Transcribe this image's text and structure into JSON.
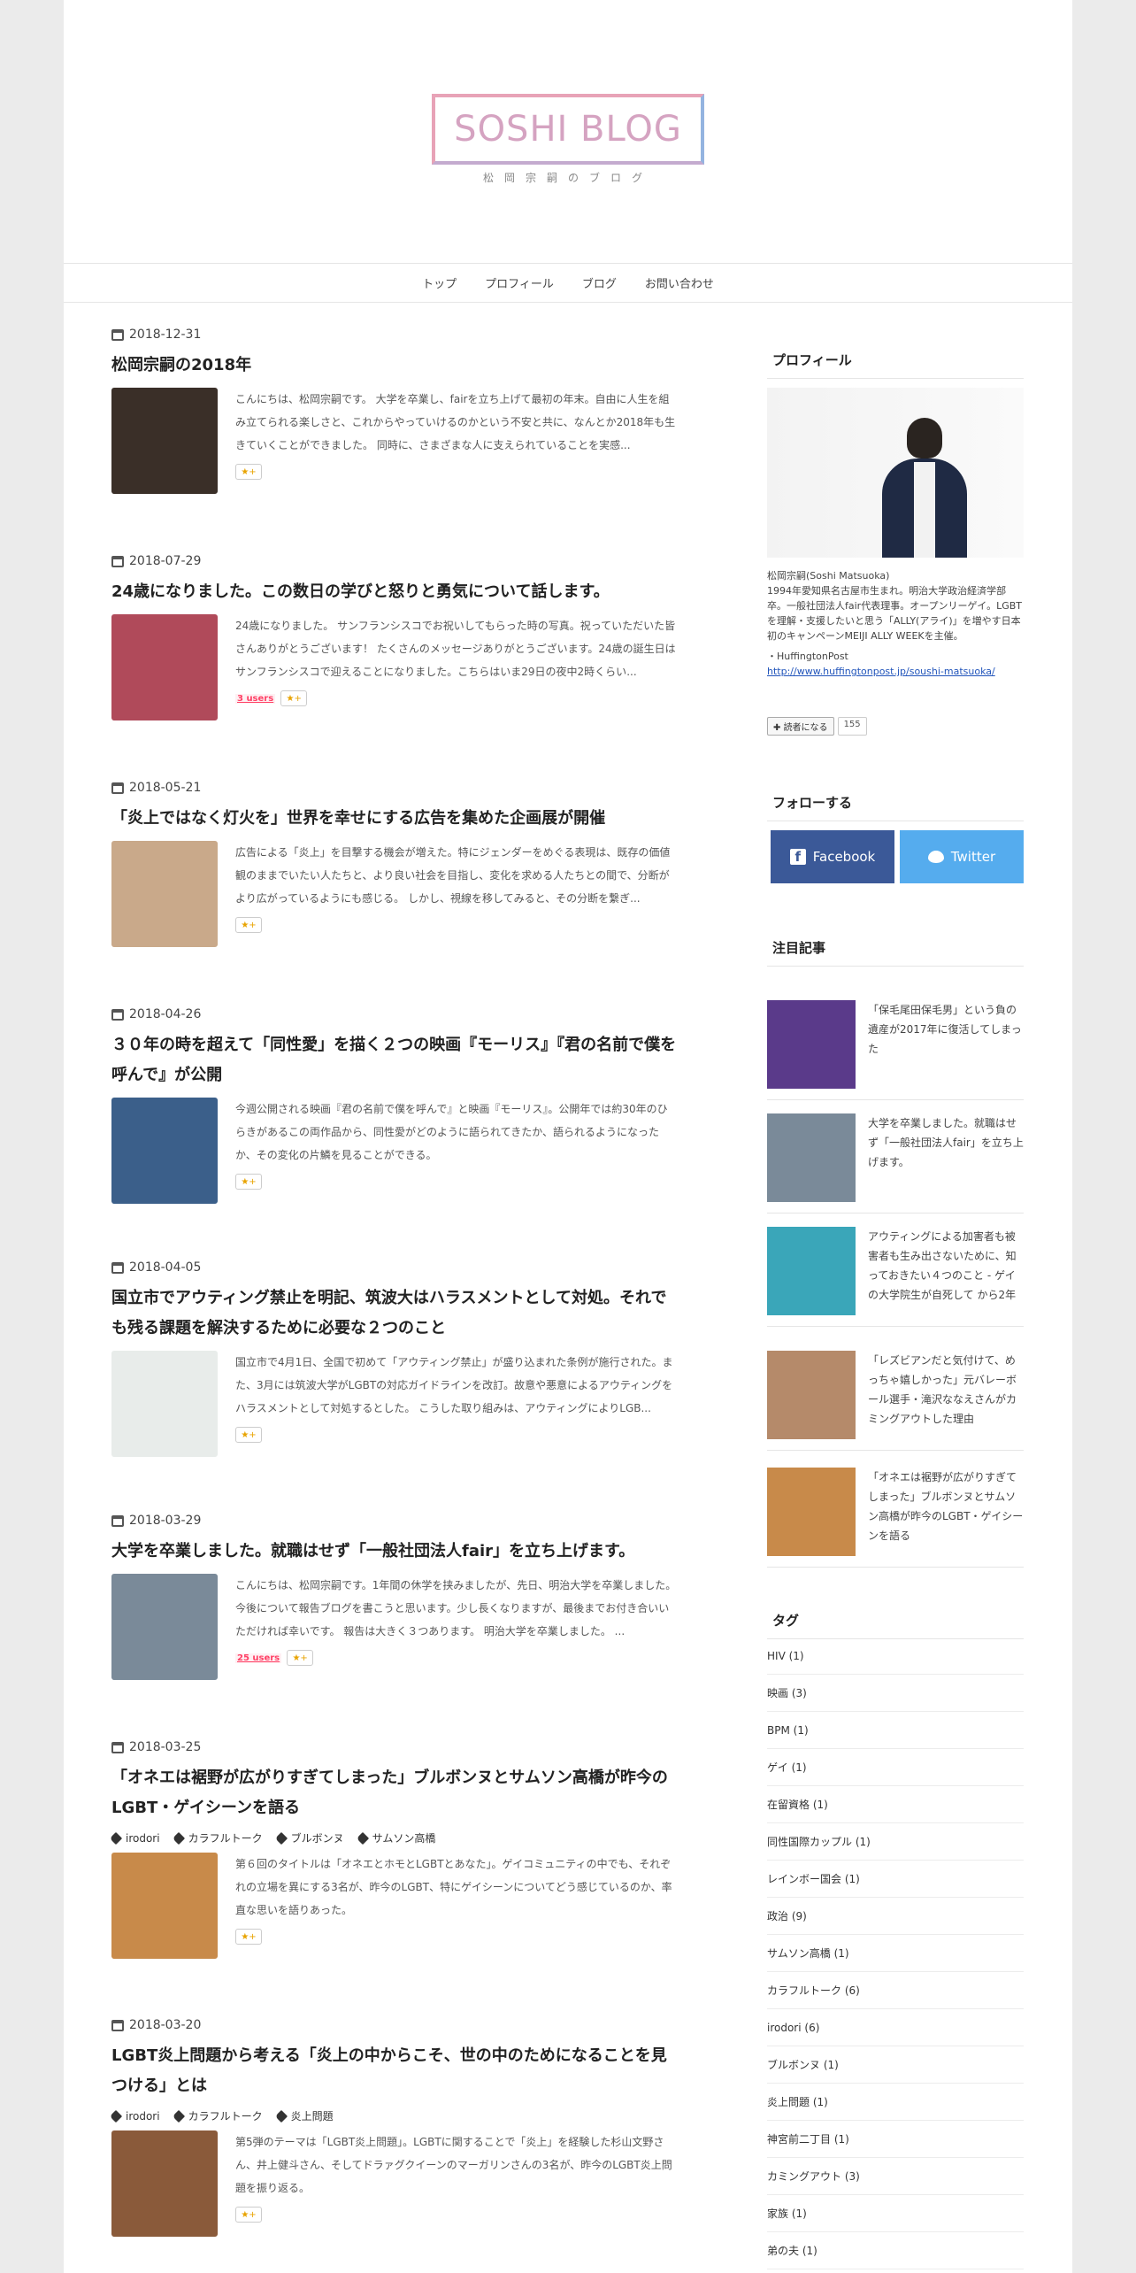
{
  "blog": {
    "title": "SOSHI BLOG",
    "subtitle": "松岡宗嗣のブログ"
  },
  "nav": [
    "トップ",
    "プロフィール",
    "ブログ",
    "お問い合わせ"
  ],
  "entries": [
    {
      "date": "2018-12-31",
      "title": "松岡宗嗣の2018年",
      "excerpt": "こんにちは、松岡宗嗣です。 大学を卒業し、fairを立ち上げて最初の年末。自由に人生を組み立てられる楽しさと、これからやっていけるのかという不安と共に、なんとか2018年も生きていくことができました。 同時に、さまざまな人に支えられていることを実感...",
      "users": "",
      "thumb_color": "#3a2f28"
    },
    {
      "date": "2018-07-29",
      "title": "24歳になりました。この数日の学びと怒りと勇気について話します。",
      "excerpt": "24歳になりました。 サンフランシスコでお祝いしてもらった時の写真。祝っていただいた皆さんありがとうございます！ たくさんのメッセージありがとうございます。24歳の誕生日はサンフランシスコで迎えることになりました。こちらはいま29日の夜中2時くらい...",
      "users": "3 users",
      "thumb_color": "#b04a5a"
    },
    {
      "date": "2018-05-21",
      "title": "「炎上ではなく灯火を」世界を幸せにする広告を集めた企画展が開催",
      "excerpt": "広告による「炎上」を目撃する機会が増えた。特にジェンダーをめぐる表現は、既存の価値観のままでいたい人たちと、より良い社会を目指し、変化を求める人たちとの間で、分断がより広がっているようにも感じる。 しかし、視線を移してみると、その分断を繋ぎ...",
      "users": "",
      "thumb_color": "#c9a98a"
    },
    {
      "date": "2018-04-26",
      "title": "３０年の時を超えて「同性愛」を描く２つの映画『モーリス』『君の名前で僕を呼んで』が公開",
      "excerpt": "今週公開される映画『君の名前で僕を呼んで』と映画『モーリス』。公開年では約30年のひらきがあるこの両作品から、同性愛がどのように語られてきたか、語られるようになったか、その変化の片鱗を見ることができる。",
      "users": "",
      "thumb_color": "#3b5f8a"
    },
    {
      "date": "2018-04-05",
      "title": "国立市でアウティング禁止を明記、筑波大はハラスメントとして対処。それでも残る課題を解決するために必要な２つのこと",
      "excerpt": "国立市で4月1日、全国で初めて「アウティング禁止」が盛り込まれた条例が施行された。また、3月には筑波大学がLGBTの対応ガイドラインを改訂。故意や悪意によるアウティングをハラスメントとして対処するとした。 こうした取り組みは、アウティングによりLGB...",
      "users": "",
      "thumb_color": "#e8ecea"
    },
    {
      "date": "2018-03-29",
      "title": "大学を卒業しました。就職はせず「一般社団法人fair」を立ち上げます。",
      "excerpt": "こんにちは、松岡宗嗣です。1年間の休学を挟みましたが、先日、明治大学を卒業しました。 今後について報告ブログを書こうと思います。少し長くなりますが、最後までお付き合いいただければ幸いです。 報告は大きく３つあります。 明治大学を卒業しました。 ...",
      "users": "25 users",
      "thumb_color": "#7a8a99"
    },
    {
      "date": "2018-03-25",
      "title": "「オネエは裾野が広がりすぎてしまった」ブルボンヌとサムソン高橋が昨今のLGBT・ゲイシーンを語る",
      "tags": [
        "irodori",
        "カラフルトーク",
        "ブルボンヌ",
        "サムソン高橋"
      ],
      "excerpt": "第６回のタイトルは「オネエとホモとLGBTとあなた」。ゲイコミュニティの中でも、それぞれの立場を異にする3名が、昨今のLGBT、特にゲイシーンについてどう感じているのか、率直な思いを語りあった。",
      "users": "",
      "thumb_color": "#c88a4a"
    },
    {
      "date": "2018-03-20",
      "title": "LGBT炎上問題から考える「炎上の中からこそ、世の中のためになることを見つける」とは",
      "tags": [
        "irodori",
        "カラフルトーク",
        "炎上問題"
      ],
      "excerpt": "第5弾のテーマは「LGBT炎上問題」。LGBTに関することで「炎上」を経験した杉山文野さん、井上健斗さん、そしてドラァグクイーンのマーガリンさんの3名が、昨今のLGBT炎上問題を振り返る。",
      "users": "",
      "thumb_color": "#8a5a3a"
    }
  ],
  "sidebar": {
    "profile_heading": "プロフィール",
    "profile_lines": [
      "松岡宗嗣(Soshi Matsuoka)",
      "1994年愛知県名古屋市生まれ。明治大学政治経済学部卒。一般社団法人fair代表理事。オープンリーゲイ。LGBTを理解・支援したいと思う「ALLY(アライ)」を増やす日本初のキャンペーンMEIJI ALLY WEEKを主催。",
      "・HuffingtonPost"
    ],
    "profile_link": "http://www.huffingtonpost.jp/soushi-matsuoka/",
    "reader_button": "読者になる",
    "reader_count": "155",
    "follow_heading": "フォローする",
    "facebook": "Facebook",
    "twitter": "Twitter",
    "featured_heading": "注目記事",
    "featured": [
      {
        "text": "「保毛尾田保毛男」という負の遺産が2017年に復活してしまった",
        "color": "#5a3a8a"
      },
      {
        "text": "大学を卒業しました。就職はせず「一般社団法人fair」を立ち上げます。",
        "color": "#7a8a99"
      },
      {
        "text": "アウティングによる加害者も被害者も生み出さないために、知っておきたい４つのこと - ゲイの大学院生が自死して から2年",
        "color": "#3aa6b9"
      },
      {
        "text": "「レズビアンだと気付けて、めっちゃ嬉しかった」元バレーボール選手・滝沢ななえさんがカミングアウトした理由",
        "color": "#b58a6a"
      },
      {
        "text": "「オネエは裾野が広がりすぎてしまった」ブルボンヌとサムソン高橋が昨今のLGBT・ゲイシーンを語る",
        "color": "#c88a4a"
      }
    ],
    "tags_heading": "タグ",
    "tags": [
      "HIV (1)",
      "映画 (3)",
      "BPM (1)",
      "ゲイ (1)",
      "在留資格 (1)",
      "同性国際カップル (1)",
      "レインボー国会 (1)",
      "政治 (9)",
      "サムソン高橋 (1)",
      "カラフルトーク (6)",
      "irodori (6)",
      "ブルボンヌ (1)",
      "炎上問題 (1)",
      "神宮前二丁目 (1)",
      "カミングアウト (3)",
      "家族 (1)",
      "弟の夫 (1)"
    ]
  }
}
